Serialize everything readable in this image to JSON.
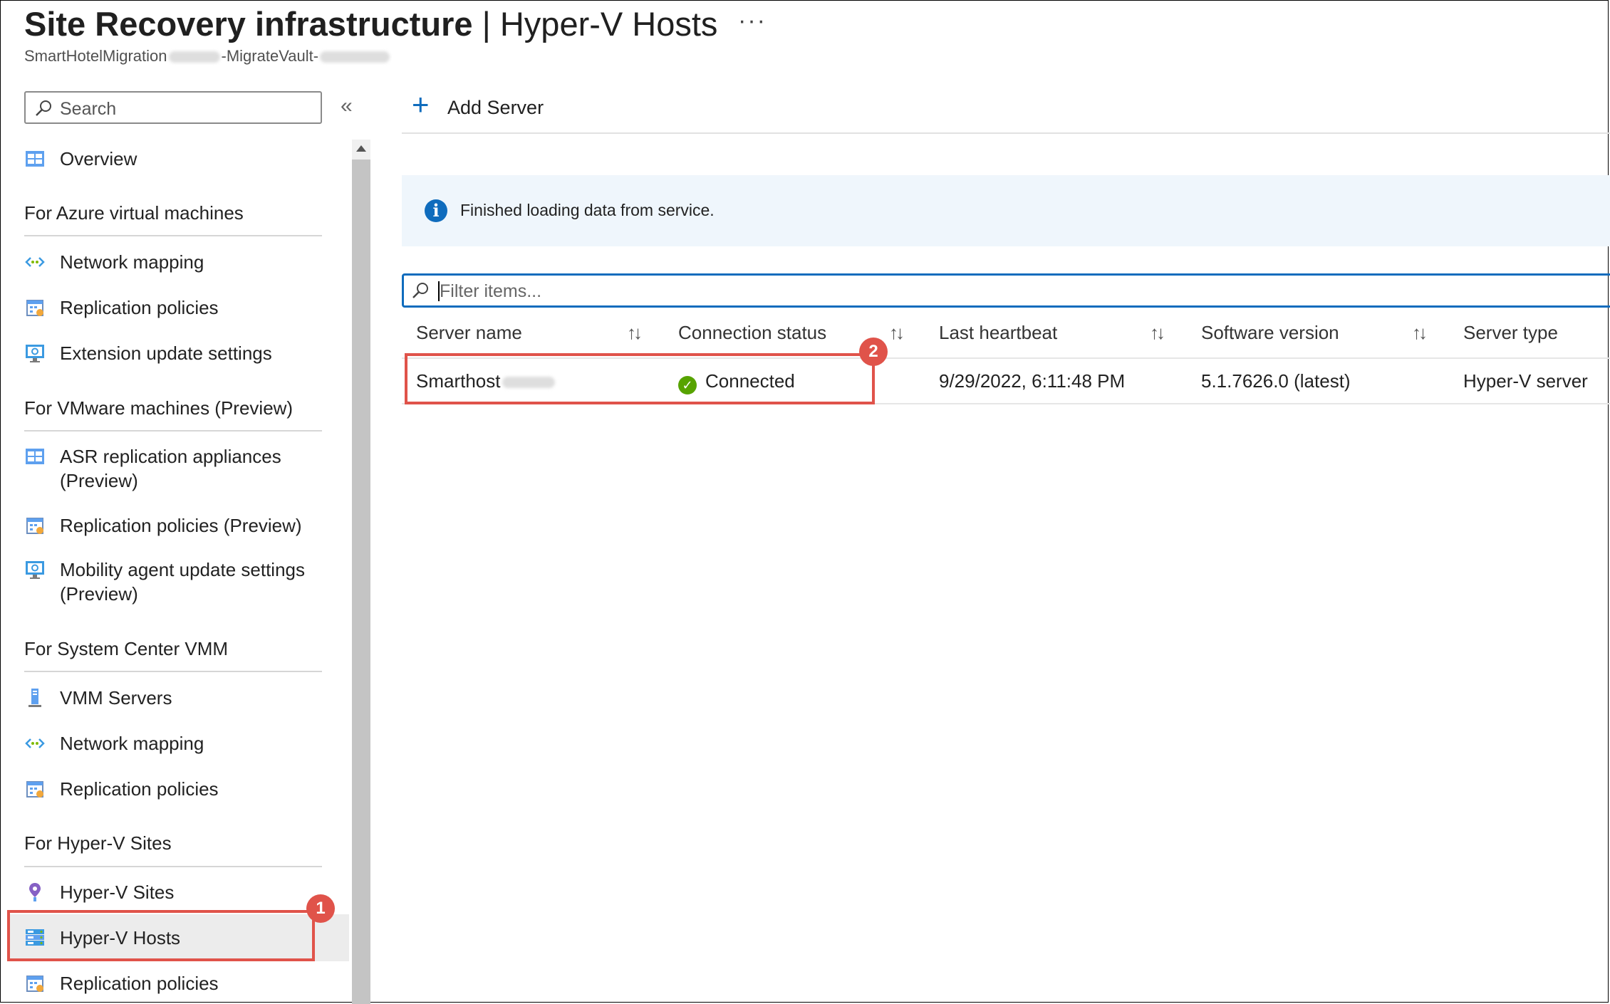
{
  "header": {
    "title_bold": "Site Recovery infrastructure",
    "title_rest": "| Hyper-V Hosts",
    "more": "···",
    "breadcrumb_part1": "SmartHotelMigration",
    "breadcrumb_part2": "-MigrateVault-"
  },
  "sidebar": {
    "search_placeholder": "Search",
    "collapse": "«",
    "overview": "Overview",
    "sections": [
      {
        "title": "For Azure virtual machines",
        "items": [
          {
            "label": "Network mapping",
            "icon": "network-mapping-icon"
          },
          {
            "label": "Replication policies",
            "icon": "replication-policies-icon"
          },
          {
            "label": "Extension update settings",
            "icon": "extension-update-icon"
          }
        ]
      },
      {
        "title": "For VMware machines (Preview)",
        "items": [
          {
            "label": "ASR replication appliances",
            "sub": "(Preview)",
            "icon": "appliance-icon"
          },
          {
            "label": "Replication policies (Preview)",
            "icon": "replication-policies-icon"
          },
          {
            "label": "Mobility agent update settings",
            "sub": "(Preview)",
            "icon": "mobility-agent-icon"
          }
        ]
      },
      {
        "title": "For System Center VMM",
        "items": [
          {
            "label": "VMM Servers",
            "icon": "vmm-server-icon"
          },
          {
            "label": "Network mapping",
            "icon": "network-mapping-icon"
          },
          {
            "label": "Replication policies",
            "icon": "replication-policies-icon"
          }
        ]
      },
      {
        "title": "For Hyper-V Sites",
        "items": [
          {
            "label": "Hyper-V Sites",
            "icon": "hyperv-site-icon"
          },
          {
            "label": "Hyper-V Hosts",
            "icon": "hyperv-host-icon",
            "selected": true
          },
          {
            "label": "Replication policies",
            "icon": "replication-policies-icon"
          }
        ]
      }
    ]
  },
  "toolbar": {
    "add_server": "Add Server"
  },
  "info_bar": {
    "message": "Finished loading data from service."
  },
  "filter": {
    "placeholder": "Filter items..."
  },
  "table": {
    "columns": [
      "Server name",
      "Connection status",
      "Last heartbeat",
      "Software version",
      "Server type"
    ],
    "rows": [
      {
        "server_name": "Smarthost",
        "connection_status": "Connected",
        "last_heartbeat": "9/29/2022, 6:11:48 PM",
        "software_version": "5.1.7626.0 (latest)",
        "server_type": "Hyper-V server"
      }
    ]
  },
  "callouts": [
    "1",
    "2"
  ],
  "colors": {
    "accent": "#0f6cbd",
    "callout": "#e0534a",
    "success": "#57a300"
  }
}
